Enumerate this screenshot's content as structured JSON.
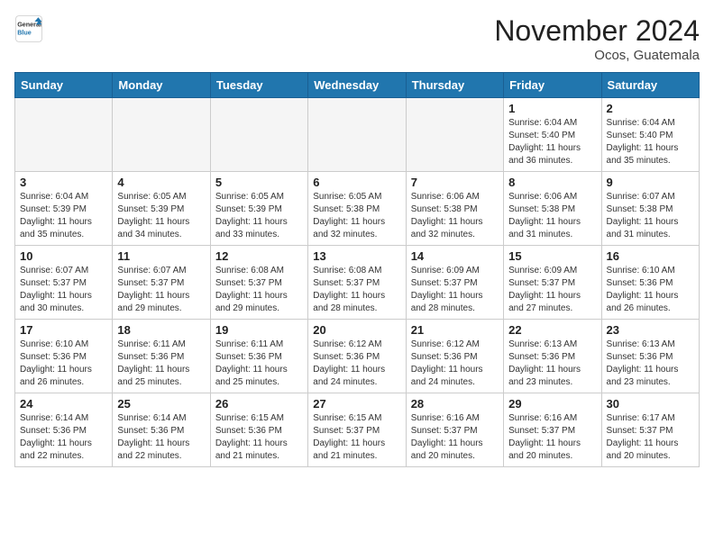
{
  "header": {
    "logo_line1": "General",
    "logo_line2": "Blue",
    "month": "November 2024",
    "location": "Ocos, Guatemala"
  },
  "weekdays": [
    "Sunday",
    "Monday",
    "Tuesday",
    "Wednesday",
    "Thursday",
    "Friday",
    "Saturday"
  ],
  "weeks": [
    [
      {
        "day": "",
        "info": ""
      },
      {
        "day": "",
        "info": ""
      },
      {
        "day": "",
        "info": ""
      },
      {
        "day": "",
        "info": ""
      },
      {
        "day": "",
        "info": ""
      },
      {
        "day": "1",
        "info": "Sunrise: 6:04 AM\nSunset: 5:40 PM\nDaylight: 11 hours\nand 36 minutes."
      },
      {
        "day": "2",
        "info": "Sunrise: 6:04 AM\nSunset: 5:40 PM\nDaylight: 11 hours\nand 35 minutes."
      }
    ],
    [
      {
        "day": "3",
        "info": "Sunrise: 6:04 AM\nSunset: 5:39 PM\nDaylight: 11 hours\nand 35 minutes."
      },
      {
        "day": "4",
        "info": "Sunrise: 6:05 AM\nSunset: 5:39 PM\nDaylight: 11 hours\nand 34 minutes."
      },
      {
        "day": "5",
        "info": "Sunrise: 6:05 AM\nSunset: 5:39 PM\nDaylight: 11 hours\nand 33 minutes."
      },
      {
        "day": "6",
        "info": "Sunrise: 6:05 AM\nSunset: 5:38 PM\nDaylight: 11 hours\nand 32 minutes."
      },
      {
        "day": "7",
        "info": "Sunrise: 6:06 AM\nSunset: 5:38 PM\nDaylight: 11 hours\nand 32 minutes."
      },
      {
        "day": "8",
        "info": "Sunrise: 6:06 AM\nSunset: 5:38 PM\nDaylight: 11 hours\nand 31 minutes."
      },
      {
        "day": "9",
        "info": "Sunrise: 6:07 AM\nSunset: 5:38 PM\nDaylight: 11 hours\nand 31 minutes."
      }
    ],
    [
      {
        "day": "10",
        "info": "Sunrise: 6:07 AM\nSunset: 5:37 PM\nDaylight: 11 hours\nand 30 minutes."
      },
      {
        "day": "11",
        "info": "Sunrise: 6:07 AM\nSunset: 5:37 PM\nDaylight: 11 hours\nand 29 minutes."
      },
      {
        "day": "12",
        "info": "Sunrise: 6:08 AM\nSunset: 5:37 PM\nDaylight: 11 hours\nand 29 minutes."
      },
      {
        "day": "13",
        "info": "Sunrise: 6:08 AM\nSunset: 5:37 PM\nDaylight: 11 hours\nand 28 minutes."
      },
      {
        "day": "14",
        "info": "Sunrise: 6:09 AM\nSunset: 5:37 PM\nDaylight: 11 hours\nand 28 minutes."
      },
      {
        "day": "15",
        "info": "Sunrise: 6:09 AM\nSunset: 5:37 PM\nDaylight: 11 hours\nand 27 minutes."
      },
      {
        "day": "16",
        "info": "Sunrise: 6:10 AM\nSunset: 5:36 PM\nDaylight: 11 hours\nand 26 minutes."
      }
    ],
    [
      {
        "day": "17",
        "info": "Sunrise: 6:10 AM\nSunset: 5:36 PM\nDaylight: 11 hours\nand 26 minutes."
      },
      {
        "day": "18",
        "info": "Sunrise: 6:11 AM\nSunset: 5:36 PM\nDaylight: 11 hours\nand 25 minutes."
      },
      {
        "day": "19",
        "info": "Sunrise: 6:11 AM\nSunset: 5:36 PM\nDaylight: 11 hours\nand 25 minutes."
      },
      {
        "day": "20",
        "info": "Sunrise: 6:12 AM\nSunset: 5:36 PM\nDaylight: 11 hours\nand 24 minutes."
      },
      {
        "day": "21",
        "info": "Sunrise: 6:12 AM\nSunset: 5:36 PM\nDaylight: 11 hours\nand 24 minutes."
      },
      {
        "day": "22",
        "info": "Sunrise: 6:13 AM\nSunset: 5:36 PM\nDaylight: 11 hours\nand 23 minutes."
      },
      {
        "day": "23",
        "info": "Sunrise: 6:13 AM\nSunset: 5:36 PM\nDaylight: 11 hours\nand 23 minutes."
      }
    ],
    [
      {
        "day": "24",
        "info": "Sunrise: 6:14 AM\nSunset: 5:36 PM\nDaylight: 11 hours\nand 22 minutes."
      },
      {
        "day": "25",
        "info": "Sunrise: 6:14 AM\nSunset: 5:36 PM\nDaylight: 11 hours\nand 22 minutes."
      },
      {
        "day": "26",
        "info": "Sunrise: 6:15 AM\nSunset: 5:36 PM\nDaylight: 11 hours\nand 21 minutes."
      },
      {
        "day": "27",
        "info": "Sunrise: 6:15 AM\nSunset: 5:37 PM\nDaylight: 11 hours\nand 21 minutes."
      },
      {
        "day": "28",
        "info": "Sunrise: 6:16 AM\nSunset: 5:37 PM\nDaylight: 11 hours\nand 20 minutes."
      },
      {
        "day": "29",
        "info": "Sunrise: 6:16 AM\nSunset: 5:37 PM\nDaylight: 11 hours\nand 20 minutes."
      },
      {
        "day": "30",
        "info": "Sunrise: 6:17 AM\nSunset: 5:37 PM\nDaylight: 11 hours\nand 20 minutes."
      }
    ]
  ]
}
